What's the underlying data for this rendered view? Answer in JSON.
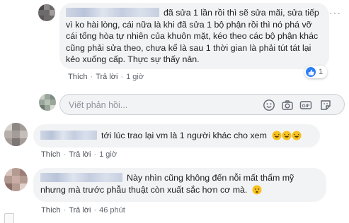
{
  "comment1": {
    "text": "đã sửa 1 lần rồi thì sẽ sửa mãi, sửa tiếp vì ko hài lòng, cái nữa là khi đã sửa 1 bộ phận rồi thì nó phá vỡ cái tổng hòa tự nhiên của khuôn mặt, kéo theo các bộ phận khác cũng phải sửa theo, chưa kể là sau 1 thời gian là phải tút tát lại kẻo xuống cấp. Thực sự thấy nản.",
    "like_label": "Thích",
    "reply_label": "Trả lời",
    "time": "1 giờ",
    "reaction_count": "1",
    "menu_dots": "···"
  },
  "reply_box": {
    "placeholder": "Viết phản hồi..."
  },
  "comment2": {
    "text": "tới lúc trao lại vm là 1 người khác cho xem",
    "like_label": "Thích",
    "reply_label": "Trả lời",
    "time": "1 giờ"
  },
  "comment3": {
    "text": "Này nhìn cũng không đến nỗi mất thẩm mỹ nhưng mà trước phẫu thuật còn xuất sắc hơn cơ mà.",
    "like_label": "Thích",
    "reply_label": "Trả lời",
    "time": "46 phút"
  },
  "icons": [
    "avatar",
    "thumbs-up-icon",
    "smiley-icon",
    "camera-icon",
    "gif-icon",
    "sticker-icon",
    "laughing-emoji-icon",
    "disappointed-emoji-icon",
    "more-options-icon"
  ],
  "colors": {
    "bubble": "#f2f3f5",
    "like_blue": "#2d7ff9",
    "meta_gray": "#606770",
    "emoji_yellow": "#f7c11e"
  }
}
